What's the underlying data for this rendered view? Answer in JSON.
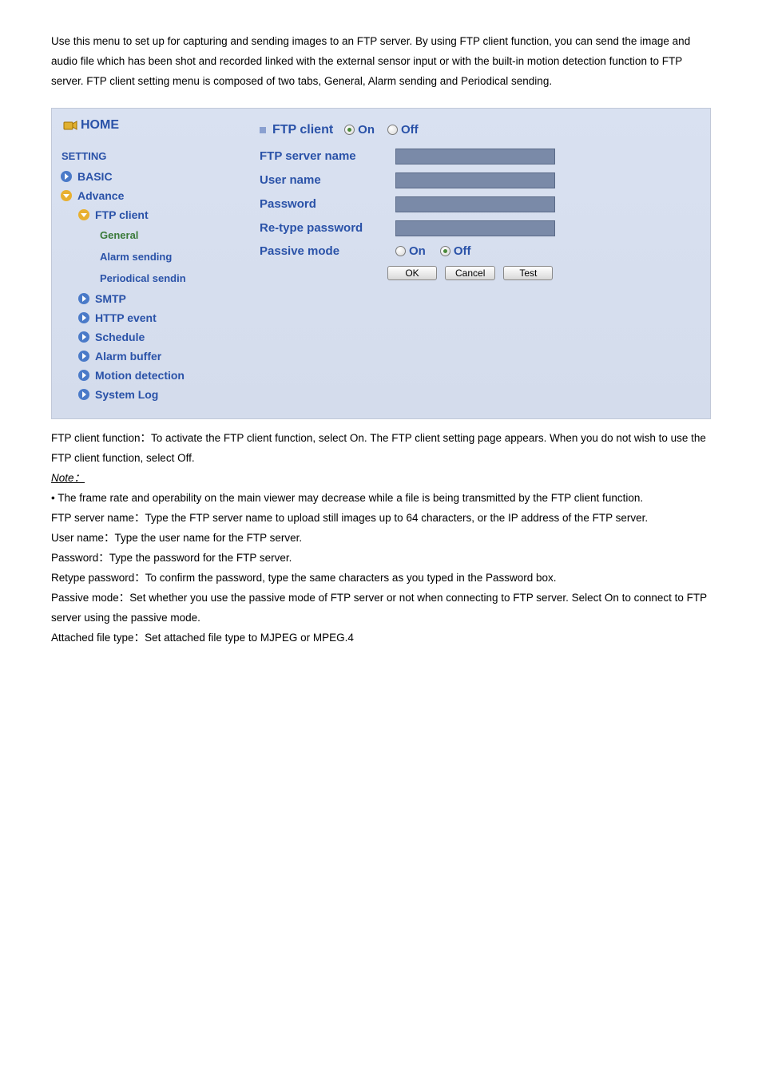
{
  "intro": "Use this menu to set up for capturing and sending images to an FTP server. By using FTP client function, you can send the image and audio file which has been shot and recorded linked with the external sensor input or with the built-in motion detection function to FTP server. FTP client setting menu is composed of two tabs, General, Alarm sending and Periodical sending.",
  "sidebar": {
    "home": "HOME",
    "setting": "SETTING",
    "basic": "BASIC",
    "advance": "Advance",
    "ftp_client": "FTP client",
    "general": "General",
    "alarm_sending": "Alarm sending",
    "periodical_sending": "Periodical sendin",
    "smtp": "SMTP",
    "http_event": "HTTP event",
    "schedule": "Schedule",
    "alarm_buffer": "Alarm buffer",
    "motion_detection": "Motion detection",
    "system_log": "System Log"
  },
  "form": {
    "title": "FTP client",
    "on": "On",
    "off": "Off",
    "server_name_label": "FTP server name",
    "user_name_label": "User name",
    "password_label": "Password",
    "retype_label": "Re-type password",
    "passive_label": "Passive mode",
    "server_name_value": "",
    "user_name_value": "",
    "password_value": "",
    "retype_value": ""
  },
  "buttons": {
    "ok": "OK",
    "cancel": "Cancel",
    "test": "Test"
  },
  "footer": {
    "p1": "FTP client function：To activate the FTP client function, select On. The FTP client setting page appears. When you do not wish to use the FTP client function, select Off.",
    "note": "Note：",
    "p2": "• The frame rate and operability on the main viewer may decrease while a file is being transmitted by the FTP client function.",
    "p3": "FTP server name：Type the FTP server name to upload still images up to 64 characters, or the IP address of the FTP server.",
    "p4": "User name：Type the user name for the FTP server.",
    "p5": "Password：Type the password for the FTP server.",
    "p6": "Retype password：To confirm the password, type the same characters as you typed in the Password box.",
    "p7": "Passive mode：Set whether you use the passive mode of FTP server or not when connecting to FTP server. Select On to connect to FTP server using the passive mode.",
    "p8": "Attached file type：Set attached file type to MJPEG or MPEG.4"
  }
}
